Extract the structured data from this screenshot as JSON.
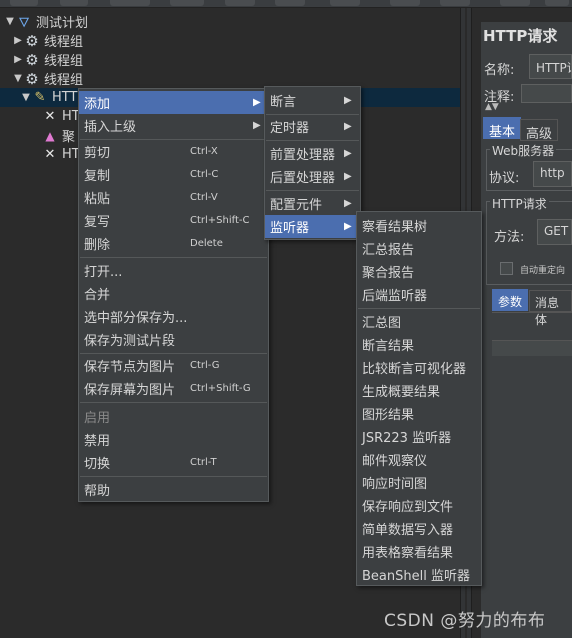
{
  "colors": {
    "background": "#2b2b2b",
    "menu_bg": "#3c3f41",
    "highlight": "#4b6eaf",
    "selected_row": "#0d293e"
  },
  "tree": {
    "items": [
      {
        "label": "测试计划",
        "icon": "flask-icon"
      },
      {
        "label": "线程组",
        "icon": "gear-icon"
      },
      {
        "label": "线程组",
        "icon": "gear-icon"
      },
      {
        "label": "线程组",
        "icon": "gear-icon"
      },
      {
        "label": "HTT",
        "icon": "pen-icon"
      },
      {
        "label": "HT",
        "icon": "assertion-cross-icon"
      },
      {
        "label": "聚",
        "icon": "chart-icon"
      },
      {
        "label": "HT",
        "icon": "assertion-cross-icon"
      }
    ]
  },
  "right_panel": {
    "title": "HTTP请求",
    "name_label": "名称:",
    "name_value": "HTTP请",
    "comment_label": "注释:",
    "tabs": [
      "基本",
      "高级"
    ],
    "web_server_title": "Web服务器",
    "protocol_label": "协议:",
    "protocol_value": "http",
    "http_request_title": "HTTP请求",
    "method_label": "方法:",
    "method_value": "GET",
    "redirect_label": "自动重定向",
    "subtabs": [
      "参数",
      "消息体"
    ]
  },
  "context_menu": {
    "items": [
      {
        "label": "添加",
        "shortcut": "",
        "submenu": true,
        "highlighted": true
      },
      {
        "label": "插入上级",
        "shortcut": "",
        "submenu": true
      },
      {
        "label": "剪切",
        "shortcut": "Ctrl-X"
      },
      {
        "label": "复制",
        "shortcut": "Ctrl-C"
      },
      {
        "label": "粘贴",
        "shortcut": "Ctrl-V"
      },
      {
        "label": "复写",
        "shortcut": "Ctrl+Shift-C"
      },
      {
        "label": "删除",
        "shortcut": "Delete"
      },
      {
        "label": "打开...",
        "shortcut": ""
      },
      {
        "label": "合并",
        "shortcut": ""
      },
      {
        "label": "选中部分保存为...",
        "shortcut": ""
      },
      {
        "label": "保存为测试片段",
        "shortcut": ""
      },
      {
        "label": "保存节点为图片",
        "shortcut": "Ctrl-G"
      },
      {
        "label": "保存屏幕为图片",
        "shortcut": "Ctrl+Shift-G"
      },
      {
        "label": "启用",
        "shortcut": "",
        "disabled": true
      },
      {
        "label": "禁用",
        "shortcut": ""
      },
      {
        "label": "切换",
        "shortcut": "Ctrl-T"
      },
      {
        "label": "帮助",
        "shortcut": ""
      }
    ]
  },
  "add_submenu": {
    "items": [
      {
        "label": "断言"
      },
      {
        "label": "定时器"
      },
      {
        "label": "前置处理器"
      },
      {
        "label": "后置处理器"
      },
      {
        "label": "配置元件"
      },
      {
        "label": "监听器",
        "highlighted": true
      }
    ]
  },
  "listener_submenu": {
    "items": [
      "察看结果树",
      "汇总报告",
      "聚合报告",
      "后端监听器",
      "汇总图",
      "断言结果",
      "比较断言可视化器",
      "生成概要结果",
      "图形结果",
      "JSR223 监听器",
      "邮件观察仪",
      "响应时间图",
      "保存响应到文件",
      "简单数据写入器",
      "用表格察看结果",
      "BeanShell 监听器"
    ]
  },
  "watermark": "CSDN @努力的布布"
}
